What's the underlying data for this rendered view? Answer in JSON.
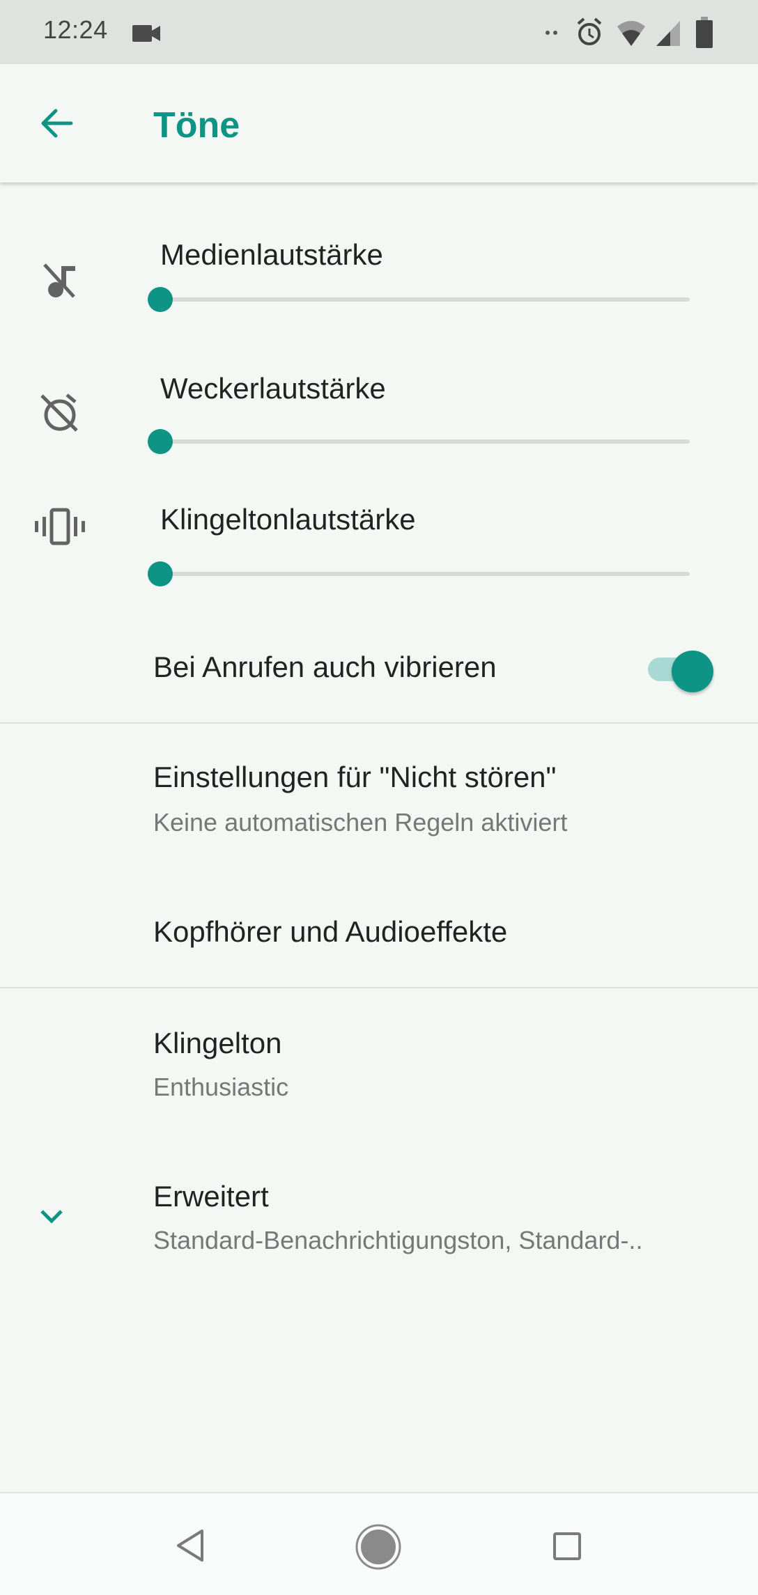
{
  "status_bar": {
    "time": "12:24",
    "icons": [
      "video-camera-icon",
      "more-notifications-icon",
      "alarm-icon",
      "wifi-icon",
      "cellular-signal-icon",
      "battery-icon"
    ]
  },
  "toolbar": {
    "back_icon": "arrow-back-icon",
    "title": "Töne"
  },
  "accent_color": "#0e9484",
  "volume_sliders": [
    {
      "label": "Medienlautstärke",
      "icon": "music-off-icon",
      "value_percent": 0
    },
    {
      "label": "Weckerlautstärke",
      "icon": "alarm-off-icon",
      "value_percent": 0
    },
    {
      "label": "Klingeltonlautstärke",
      "icon": "vibrate-icon",
      "value_percent": 0
    }
  ],
  "vibrate_toggle": {
    "label": "Bei Anrufen auch vibrieren",
    "on": true
  },
  "settings": [
    {
      "title": "Einstellungen für \"Nicht stören\"",
      "summary": "Keine automatischen Regeln aktiviert"
    },
    {
      "title": "Kopfhörer und Audioeffekte"
    },
    {
      "title": "Klingelton",
      "summary": "Enthusiastic"
    },
    {
      "title": "Erweitert",
      "summary": "Standard-Benachrichtigungston, Standard-..",
      "icon": "chevron-down-icon"
    }
  ],
  "nav_bar": {
    "back": "nav-back-icon",
    "home": "nav-home-icon",
    "recents": "nav-recents-icon"
  }
}
